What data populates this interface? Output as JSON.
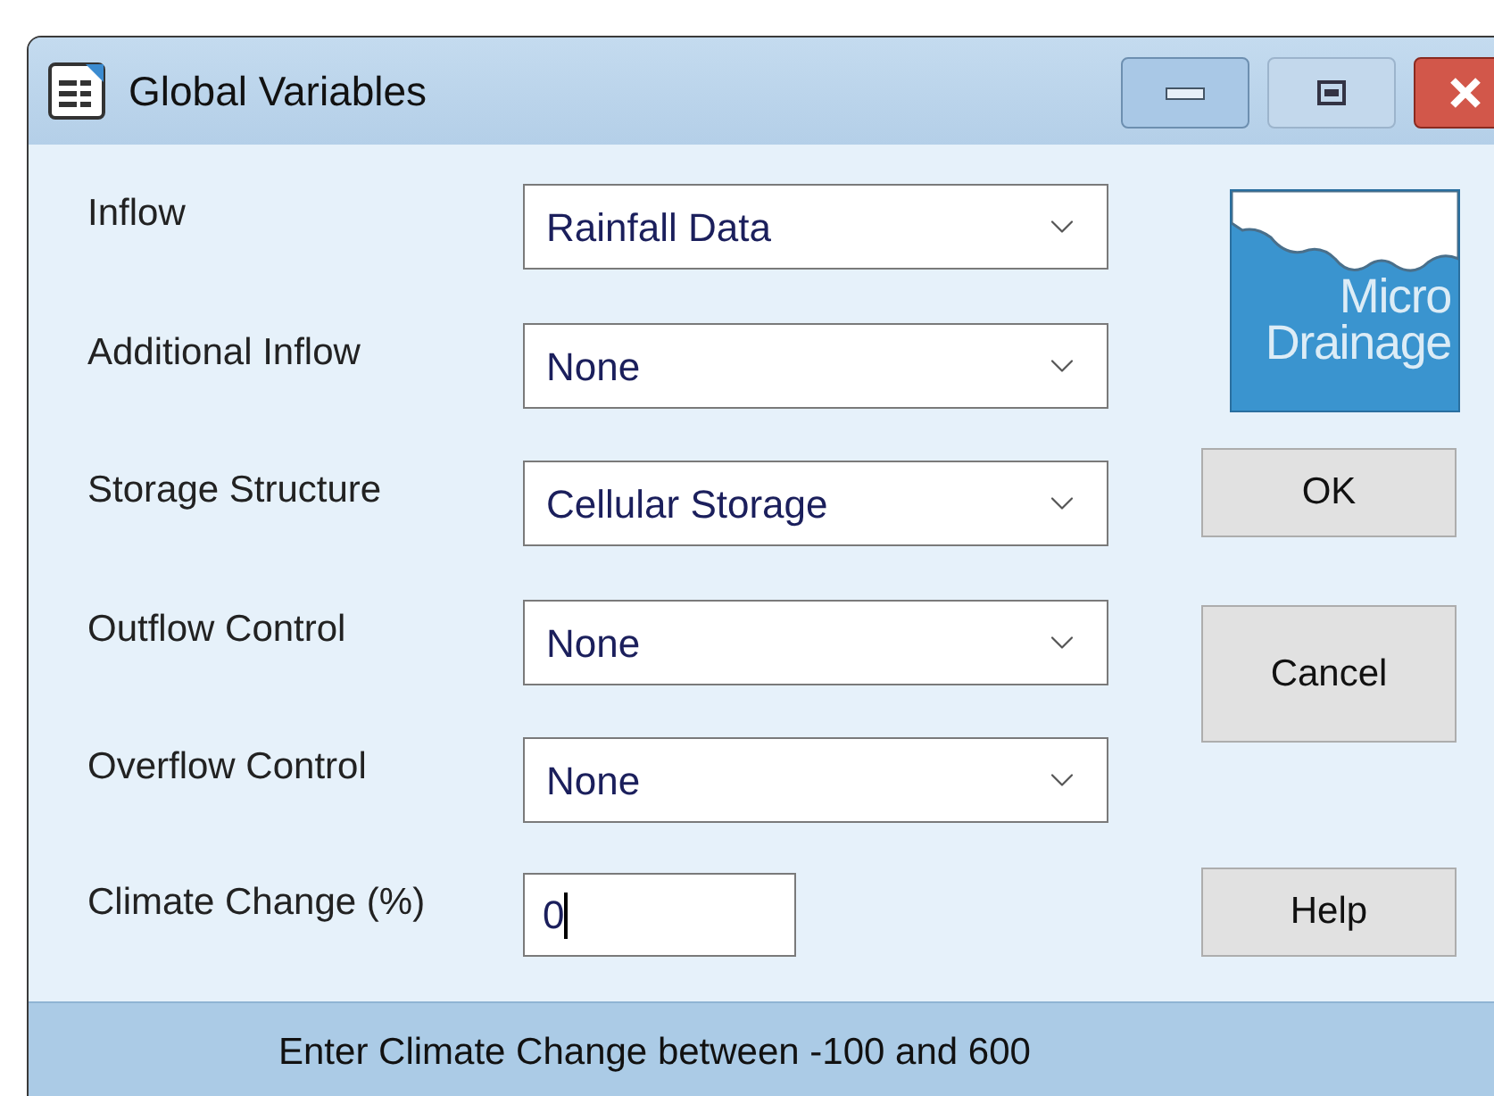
{
  "window": {
    "title": "Global Variables"
  },
  "fields": [
    {
      "label": "Inflow",
      "kind": "dropdown",
      "value": "Rainfall Data"
    },
    {
      "label": "Additional Inflow",
      "kind": "dropdown",
      "value": "None"
    },
    {
      "label": "Storage Structure",
      "kind": "dropdown",
      "value": "Cellular Storage"
    },
    {
      "label": "Outflow Control",
      "kind": "dropdown",
      "value": "None"
    },
    {
      "label": "Overflow Control",
      "kind": "dropdown",
      "value": "None"
    },
    {
      "label": "Climate Change (%)",
      "kind": "text",
      "value": "0",
      "focused": true
    }
  ],
  "logo": {
    "lines": [
      "Micro",
      "Drainage"
    ]
  },
  "buttons": [
    "OK",
    "Cancel",
    "Help"
  ],
  "status_bar": "Enter Climate Change between -100 and 600"
}
